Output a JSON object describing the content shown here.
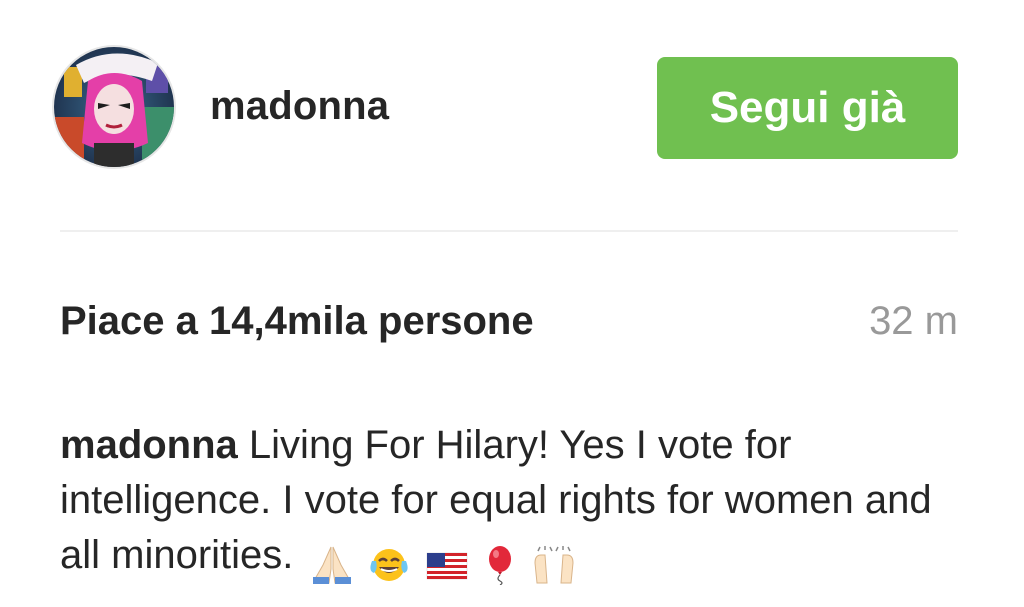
{
  "post_header": {
    "username": "madonna",
    "follow_button_label": "Segui già",
    "avatar_icon": "profile-photo",
    "accent_color": "#70c050"
  },
  "post_meta": {
    "likes_text": "Piace a 14,4mila persone",
    "time_ago": "32 m"
  },
  "caption": {
    "username": "madonna",
    "text": "Living For Hilary! Yes I vote for intelligence. I vote for equal rights for women and all minorities.",
    "emoji_icons": [
      "praying-hands-icon",
      "tears-of-joy-icon",
      "us-flag-icon",
      "balloon-icon",
      "raising-hands-icon"
    ]
  }
}
